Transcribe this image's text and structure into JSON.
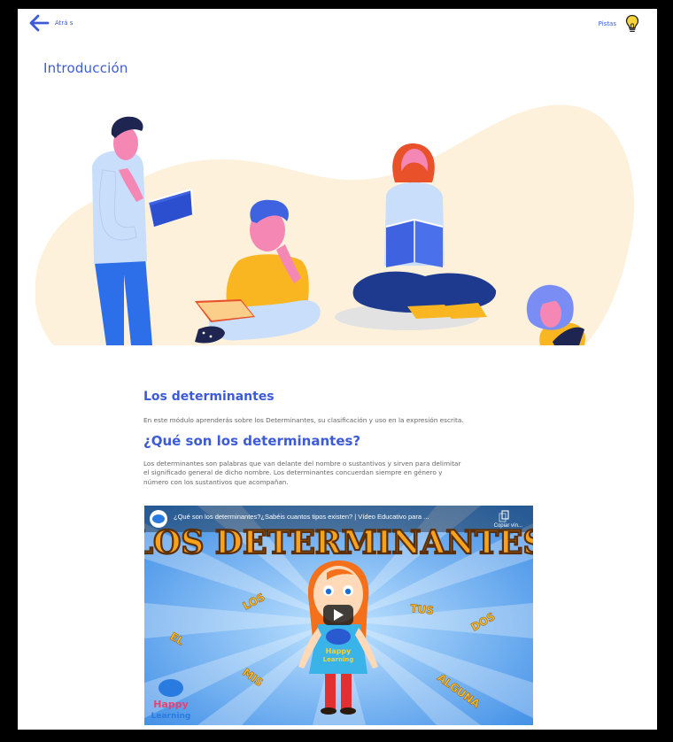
{
  "header": {
    "back_label": "Atrá s",
    "hints_label": "Pistas"
  },
  "page_title": "Introducción",
  "lesson": {
    "heading": "Los determinantes",
    "intro": "En este módulo aprenderás sobre los Determinantes, su clasificación y uso en la expresión escrita.",
    "subheading": "¿Qué son los determinantes?",
    "definition_line1": "Los determinantes son palabras que van delante del nombre o sustantivos y sirven para delimitar",
    "definition_line2": "el significado general de dicho nombre. Los determinantes concuerdan siempre en género y",
    "definition_line3": "número con los sustantivos que acompañan."
  },
  "video": {
    "title": "¿Qué son los determinantes?¿Sabéis cuantos tipos existen? | Vídeo Educativo para ...",
    "copy_label": "Copiar vín...",
    "banner_text": "LOS DETERMINANTES",
    "words": [
      "LOS",
      "TUS",
      "DOS",
      "EL",
      "MIS",
      "ALGUNA"
    ],
    "brand_line1": "Happy",
    "brand_line2": "Learning",
    "shirt_line1": "Happy",
    "shirt_line2": "Learning"
  },
  "colors": {
    "accent": "#3d5bd9",
    "hint_bulb": "#f5d33a",
    "hero_blob": "#fdf1dc"
  },
  "icons": {
    "back": "arrow-left-icon",
    "hints": "lightbulb-icon",
    "play": "play-icon",
    "copy": "copy-icon"
  }
}
